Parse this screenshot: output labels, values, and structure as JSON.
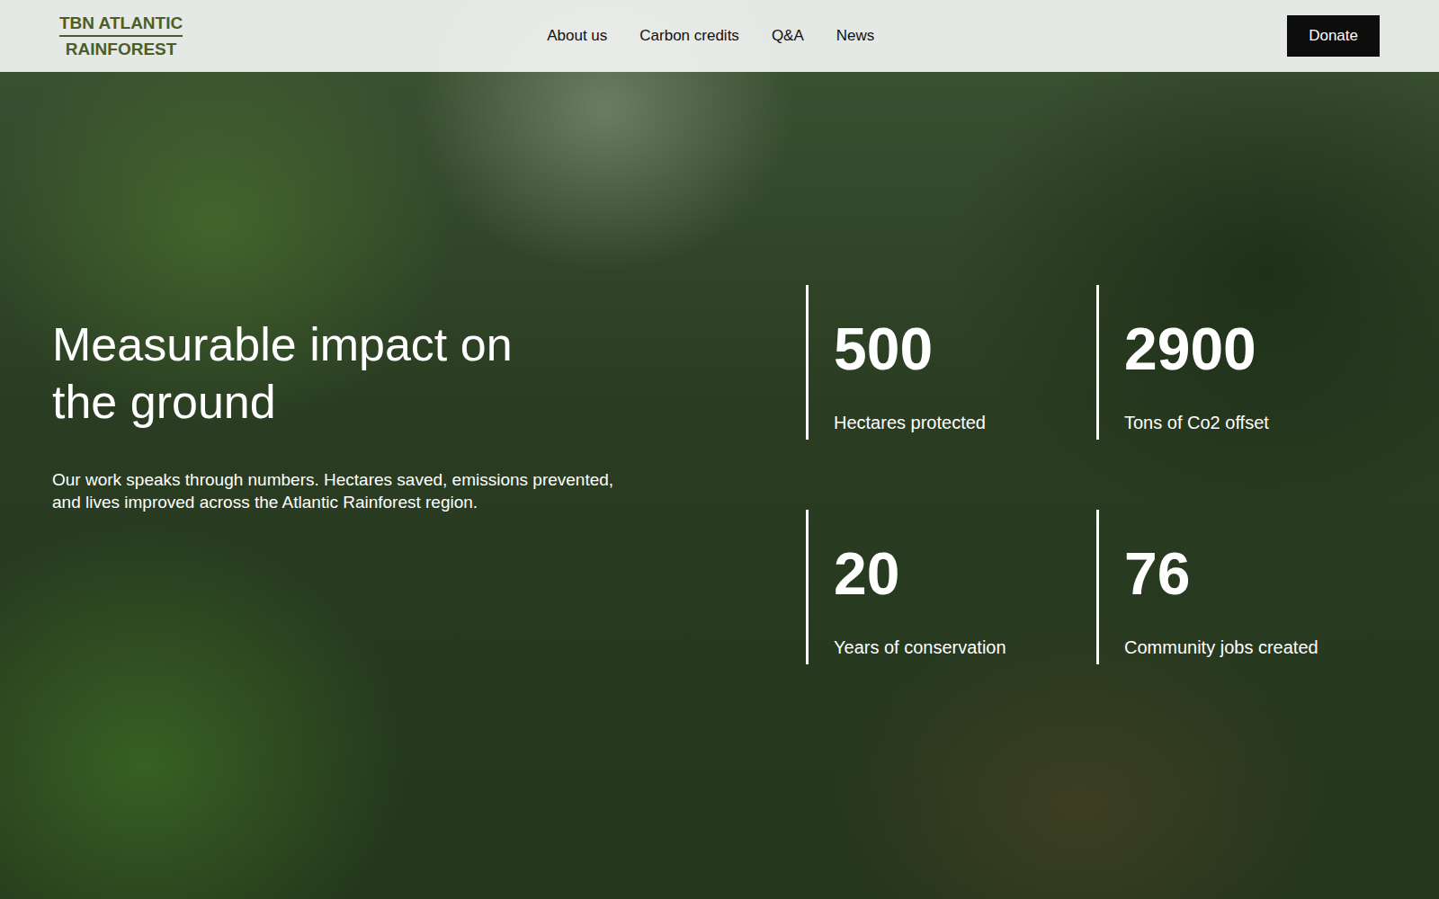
{
  "header": {
    "logo": [
      "TBN ATLANTIC",
      "RAINFOREST"
    ],
    "nav": [
      {
        "label": "About us"
      },
      {
        "label": "Carbon credits"
      },
      {
        "label": "Q&A"
      },
      {
        "label": "News"
      }
    ],
    "button": "Donate"
  },
  "hero": {
    "title": "Measurable impact on the ground",
    "description": "Our work speaks through numbers. Hectares saved, emissions prevented, and lives improved across the Atlantic Rainforest region."
  },
  "stats": [
    {
      "value": "500",
      "label": "Hectares protected"
    },
    {
      "value": "2900",
      "label": "Tons of Co2 offset"
    },
    {
      "value": "20",
      "label": "Years of conservation"
    },
    {
      "value": "76",
      "label": "Community jobs created"
    }
  ]
}
